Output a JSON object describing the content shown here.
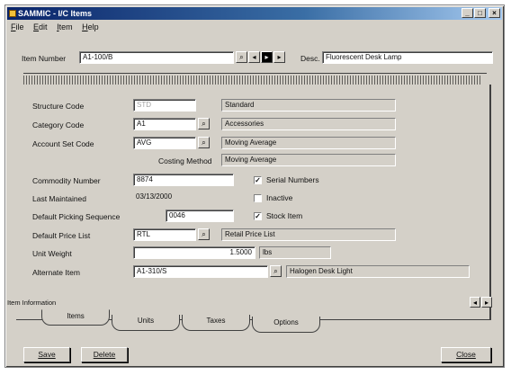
{
  "window": {
    "title": "SAMMIC - I/C Items"
  },
  "window_controls": {
    "minimize": "_",
    "maximize": "□",
    "close": "×"
  },
  "menu": [
    "File",
    "Edit",
    "Item",
    "Help"
  ],
  "header": {
    "item_number_label": "Item Number",
    "item_number_value": "A1-100/B",
    "desc_label": "Desc.",
    "desc_value": "Fluorescent Desk Lamp"
  },
  "form": {
    "structure_code": {
      "label": "Structure Code",
      "value": "STD",
      "desc": "Standard"
    },
    "category_code": {
      "label": "Category Code",
      "value": "A1",
      "desc": "Accessories"
    },
    "account_set_code": {
      "label": "Account Set Code",
      "value": "AVG",
      "desc": "Moving Average"
    },
    "costing_method": {
      "label": "Costing Method",
      "value": "Moving Average"
    },
    "commodity_number": {
      "label": "Commodity Number",
      "value": "8874"
    },
    "last_maintained": {
      "label": "Last Maintained",
      "value": "03/13/2000"
    },
    "default_picking_sequence": {
      "label": "Default Picking Sequence",
      "value": "0046"
    },
    "default_price_list": {
      "label": "Default Price List",
      "value": "RTL",
      "desc": "Retail Price List"
    },
    "unit_weight": {
      "label": "Unit Weight",
      "value": "1.5000",
      "unit": "lbs"
    },
    "alternate_item": {
      "label": "Alternate Item",
      "value": "A1-310/S",
      "desc": "Halogen Desk Light"
    },
    "checks": {
      "serial_numbers": {
        "label": "Serial Numbers",
        "checked": true
      },
      "inactive": {
        "label": "Inactive",
        "checked": false
      },
      "stock_item": {
        "label": "Stock Item",
        "checked": true
      }
    }
  },
  "status_text": "Item Information",
  "tabs": [
    "Items",
    "Units",
    "Taxes",
    "Options"
  ],
  "buttons": {
    "save": "Save",
    "delete": "Delete",
    "close": "Close"
  }
}
